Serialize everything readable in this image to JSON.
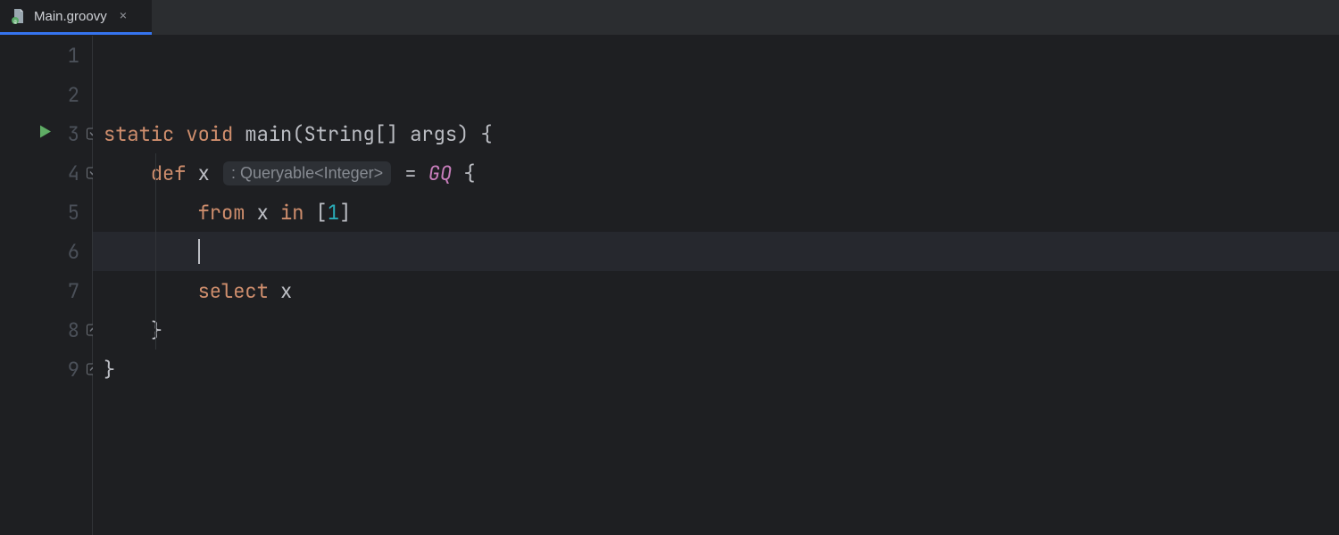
{
  "tab": {
    "filename": "Main.groovy",
    "icon_name": "groovy-file-icon"
  },
  "gutter": {
    "line_numbers": [
      "1",
      "2",
      "3",
      "4",
      "5",
      "6",
      "7",
      "8",
      "9"
    ],
    "run_marker_line": 3,
    "fold_markers": [
      {
        "line": 3,
        "dir": "down"
      },
      {
        "line": 4,
        "dir": "down"
      },
      {
        "line": 8,
        "dir": "up"
      },
      {
        "line": 9,
        "dir": "up"
      }
    ]
  },
  "code": {
    "line1": "",
    "line2": "",
    "line3": {
      "kw_static": "static",
      "kw_void": "void",
      "fn": "main",
      "params_open": "(",
      "type": "String",
      "brackets": "[]",
      "arg": " args",
      "params_close": ")",
      "brace": " {"
    },
    "line4": {
      "kw_def": "def",
      "var": " x",
      "hint": ": Queryable<Integer>",
      "eq": " = ",
      "gq": "GQ",
      "brace": " {"
    },
    "line5": {
      "kw_from": "from",
      "sp1": " ",
      "var1": "x",
      "sp2": " ",
      "kw_in": "in",
      "sp3": " ",
      "lb": "[",
      "num": "1",
      "rb": "]"
    },
    "line6": "",
    "line7": {
      "kw_select": "select",
      "sp": " ",
      "var": "x"
    },
    "line8": {
      "brace": "}"
    },
    "line9": {
      "brace": "}"
    }
  },
  "cursor": {
    "line": 6
  },
  "colors": {
    "bg": "#1e1f22",
    "tab_underline": "#3574f0",
    "keyword": "#cf8e6d",
    "number": "#2aacb8",
    "italic": "#c77dbb",
    "run": "#5fad65"
  }
}
